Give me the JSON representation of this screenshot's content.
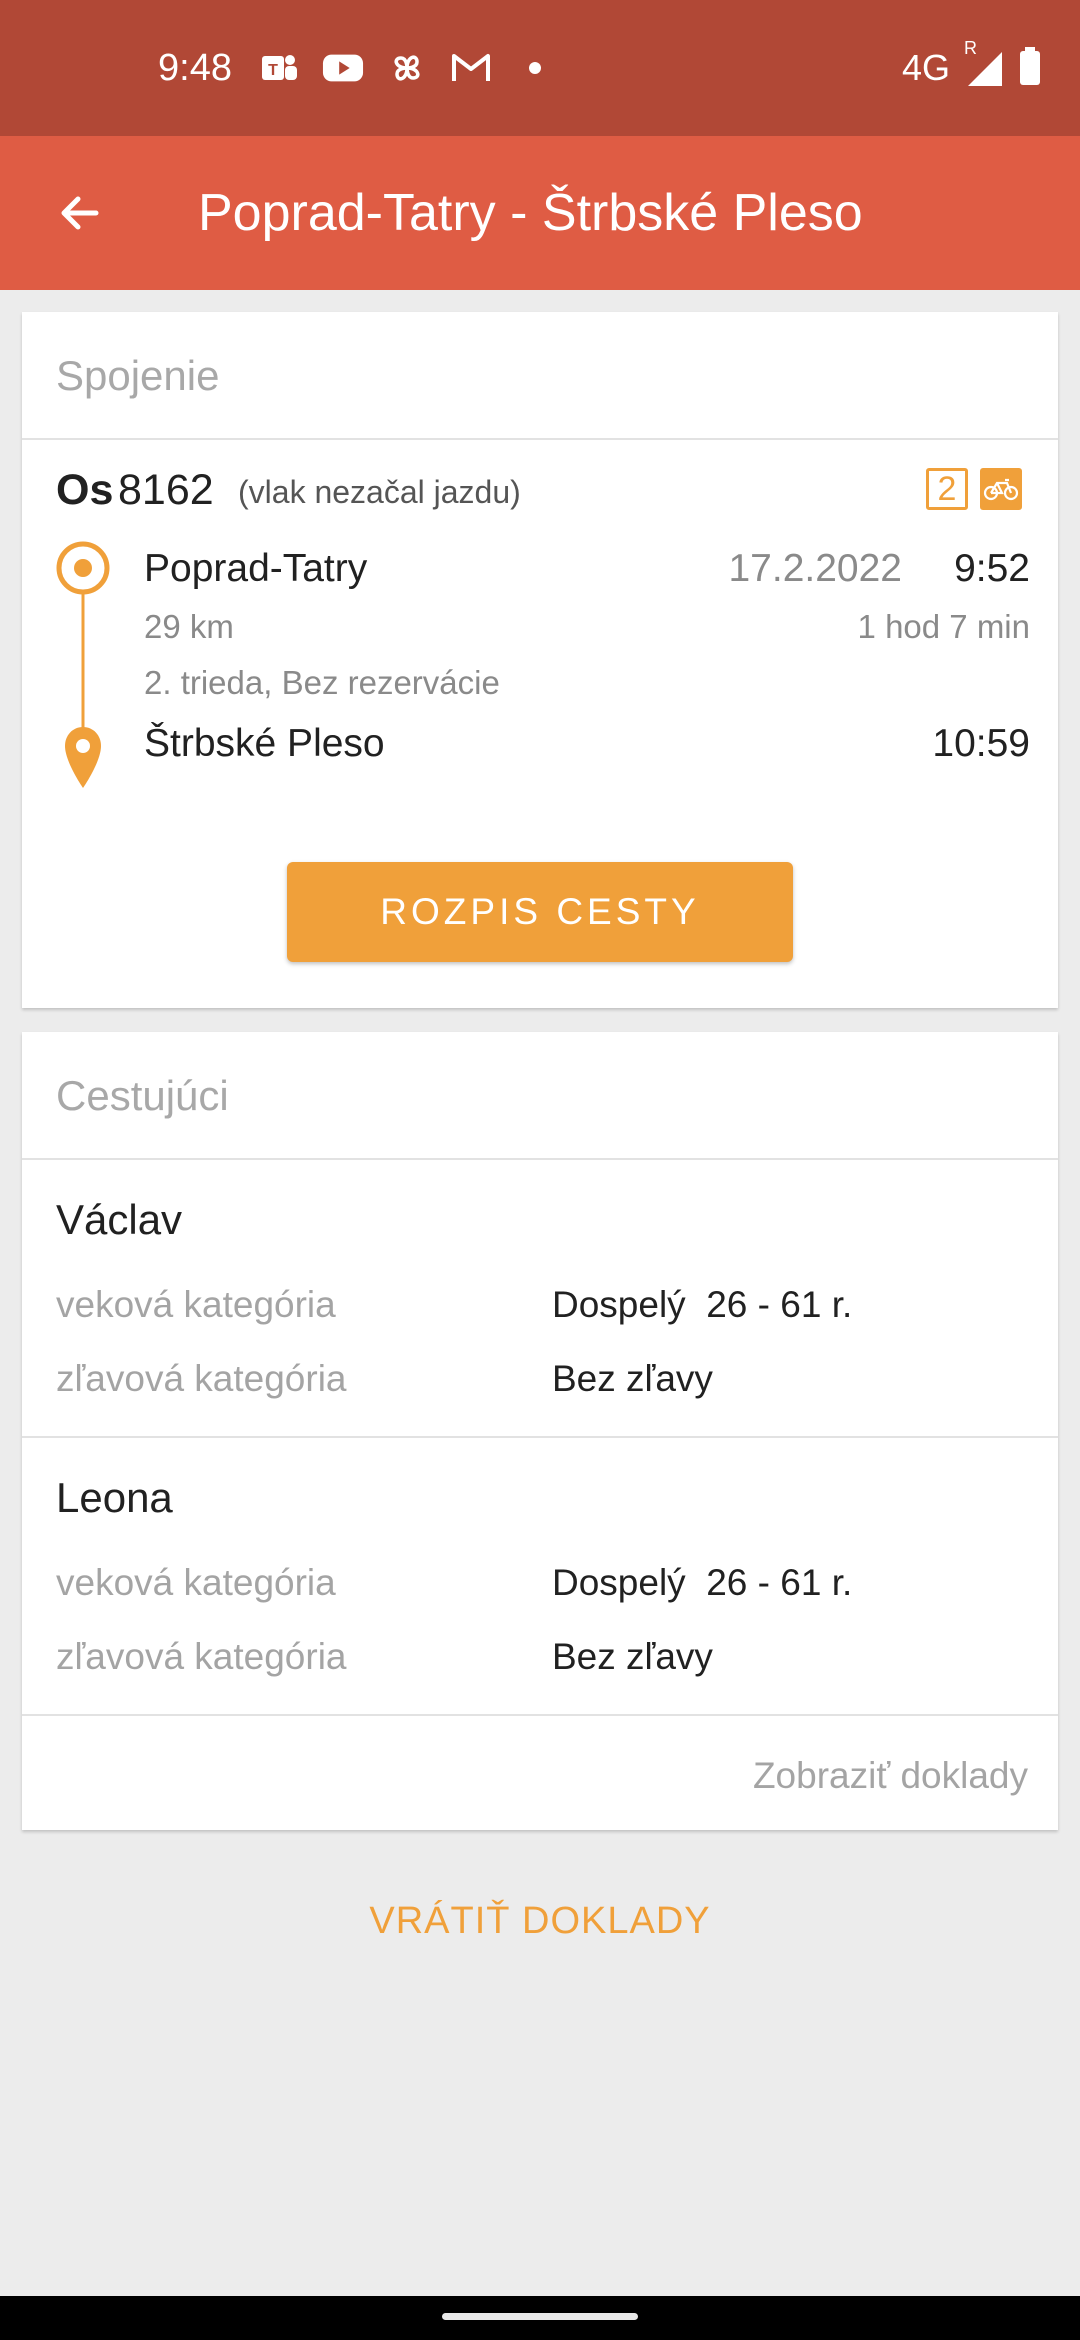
{
  "status_bar": {
    "time": "9:48",
    "network": "4G",
    "roaming": "R",
    "icons": [
      "teams-icon",
      "youtube-icon",
      "pinwheel-icon",
      "gmail-icon",
      "notification-dot-icon",
      "signal-icon",
      "battery-icon"
    ]
  },
  "app_bar": {
    "title": "Poprad-Tatry - Štrbské Pleso",
    "back_icon": "arrow-left-icon"
  },
  "connection": {
    "header": "Spojenie",
    "train_type": "Os",
    "train_number": "8162",
    "train_status": "(vlak nezačal jazdu)",
    "class_badge": "2",
    "bike_icon": "bicycle-icon",
    "origin": {
      "station": "Poprad-Tatry",
      "date": "17.2.2022",
      "time": "9:52"
    },
    "distance": "29 km",
    "duration": "1 hod 7 min",
    "service_info": "2. trieda, Bez rezervácie",
    "destination": {
      "station": "Štrbské Pleso",
      "time": "10:59"
    },
    "route_button": "ROZPIS CESTY"
  },
  "travelers": {
    "header": "Cestujúci",
    "passengers": [
      {
        "name": "Václav",
        "age_label": "veková kategória",
        "age_value": "Dospelý  26 - 61 r.",
        "discount_label": "zľavová kategória",
        "discount_value": "Bez zľavy"
      },
      {
        "name": "Leona",
        "age_label": "veková kategória",
        "age_value": "Dospelý  26 - 61 r.",
        "discount_label": "zľavová kategória",
        "discount_value": "Bez zľavy"
      }
    ],
    "show_documents": "Zobraziť doklady"
  },
  "return_documents": "VRÁTIŤ DOKLADY",
  "colors": {
    "status_bar": "#b14836",
    "app_bar": "#df5c44",
    "accent": "#f0a03a",
    "background": "#ececec"
  }
}
